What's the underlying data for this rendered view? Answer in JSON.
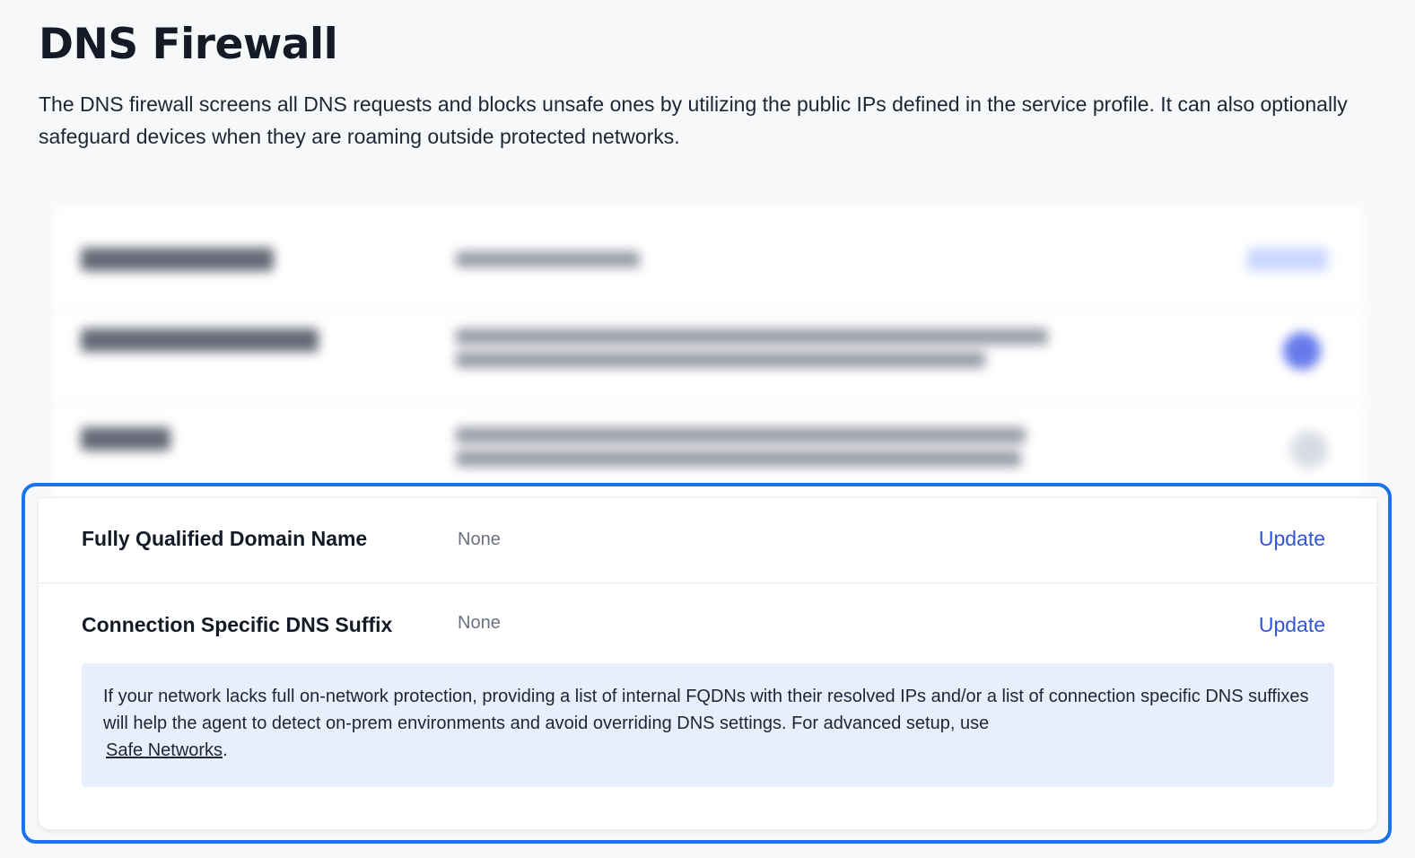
{
  "page": {
    "title": "DNS Firewall",
    "description": "The DNS firewall screens all DNS requests and blocks unsafe ones by utilizing the public IPs defined in the service profile. It can also optionally safeguard devices when they are roaming outside protected networks."
  },
  "settings": {
    "fqdn": {
      "label": "Fully Qualified Domain Name",
      "value": "None",
      "action": "Update"
    },
    "dns_suffix": {
      "label": "Connection Specific DNS Suffix",
      "value": "None",
      "action": "Update"
    }
  },
  "info": {
    "text": "If your network lacks full on-network protection, providing a list of internal FQDNs with their resolved IPs and/or a list of connection specific DNS suffixes will help the agent to detect on-prem environments and avoid overriding DNS settings. For advanced setup, use",
    "link_label": "Safe Networks",
    "suffix": "."
  },
  "colors": {
    "accent": "#1a73e8",
    "link": "#3355d6",
    "info_background": "#e8eefc"
  }
}
